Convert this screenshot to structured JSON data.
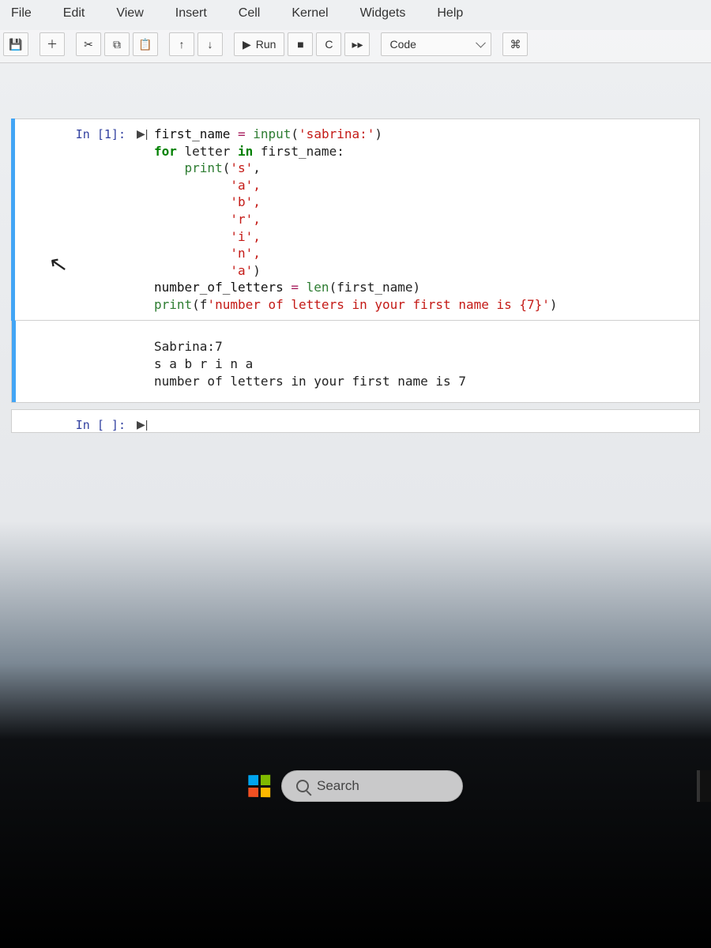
{
  "menu": {
    "file": "File",
    "edit": "Edit",
    "view": "View",
    "insert": "Insert",
    "cell": "Cell",
    "kernel": "Kernel",
    "widgets": "Widgets",
    "help": "Help"
  },
  "toolbar": {
    "run_label": "Run",
    "celltype_selected": "Code"
  },
  "cells": {
    "c1": {
      "prompt": "In [1]:",
      "code": {
        "l1a": "first_name ",
        "l1b": "=",
        "l1c": " input",
        "l1d": "(",
        "l1e": "'sabrina:'",
        "l1f": ")",
        "l2a": "for",
        "l2b": " letter ",
        "l2c": "in",
        "l2d": " first_name:",
        "l3a": "    ",
        "l3b": "print",
        "l3c": "(",
        "l3d": "'s'",
        "l3e": ",",
        "l4": "          'a',",
        "l5": "          'b',",
        "l6": "          'r',",
        "l7": "          'i',",
        "l8": "          'n',",
        "l9a": "          ",
        "l9b": "'a'",
        "l9c": ")",
        "l10a": "number_of_letters ",
        "l10b": "=",
        "l10c": " len",
        "l10d": "(first_name)",
        "l11a": "print",
        "l11b": "(f",
        "l11c": "'number of letters in your first name is {7}'",
        "l11d": ")"
      },
      "output": "Sabrina:7\ns a b r i n a\nnumber of letters in your first name is 7"
    },
    "c2": {
      "prompt": "In [ ]:"
    }
  },
  "taskbar": {
    "search_placeholder": "Search"
  }
}
